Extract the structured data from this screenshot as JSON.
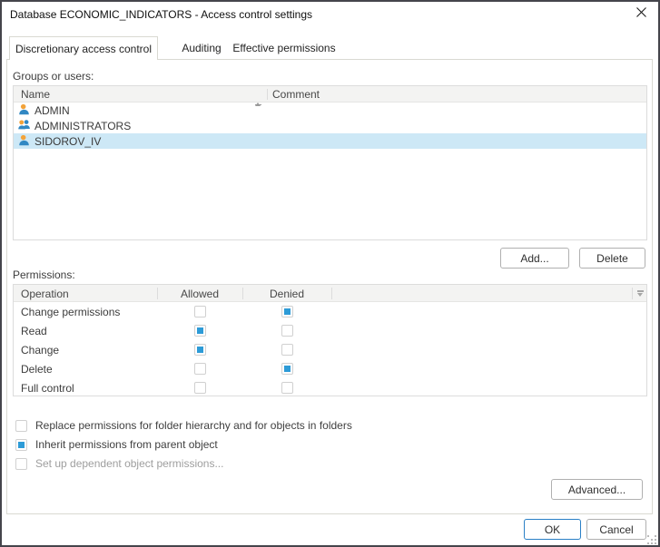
{
  "window": {
    "title": "Database ECONOMIC_INDICATORS - Access control settings"
  },
  "icons": {
    "close": "thin-x",
    "sort": "triangle-up-with-underline",
    "filter": "triangle-down-with-overline",
    "user": "person-orange-head-blue-body",
    "group": "two-people"
  },
  "tabs": [
    {
      "label": "Discretionary access control",
      "active": true
    },
    {
      "label": "Auditing",
      "active": false
    },
    {
      "label": "Effective permissions",
      "active": false
    }
  ],
  "groups_section": {
    "label": "Groups or users:",
    "columns": [
      "Name",
      "Comment"
    ],
    "rows": [
      {
        "name": "ADMIN",
        "icon": "user-icon",
        "selected": false
      },
      {
        "name": "ADMINISTRATORS",
        "icon": "group-icon",
        "selected": false
      },
      {
        "name": "SIDOROV_IV",
        "icon": "user-icon",
        "selected": true
      }
    ],
    "add_label": "Add...",
    "delete_label": "Delete"
  },
  "permissions_section": {
    "label": "Permissions:",
    "columns": [
      "Operation",
      "Allowed",
      "Denied"
    ],
    "rows": [
      {
        "operation": "Change permissions",
        "allowed": false,
        "denied": true
      },
      {
        "operation": "Read",
        "allowed": true,
        "denied": false
      },
      {
        "operation": "Change",
        "allowed": true,
        "denied": false
      },
      {
        "operation": "Delete",
        "allowed": false,
        "denied": true
      },
      {
        "operation": "Full control",
        "allowed": false,
        "denied": false
      }
    ]
  },
  "options": [
    {
      "label": "Replace permissions for folder hierarchy and for objects in folders",
      "checked": false,
      "enabled": true
    },
    {
      "label": "Inherit permissions from parent object",
      "checked": true,
      "enabled": true
    },
    {
      "label": "Set up dependent object permissions...",
      "checked": false,
      "enabled": false
    }
  ],
  "buttons": {
    "advanced": "Advanced...",
    "ok": "OK",
    "cancel": "Cancel"
  },
  "colors": {
    "accent_blue": "#2d9bd7",
    "selection_blue": "#cde8f6",
    "ok_border": "#2a80c6",
    "dialog_border": "#45454b"
  }
}
